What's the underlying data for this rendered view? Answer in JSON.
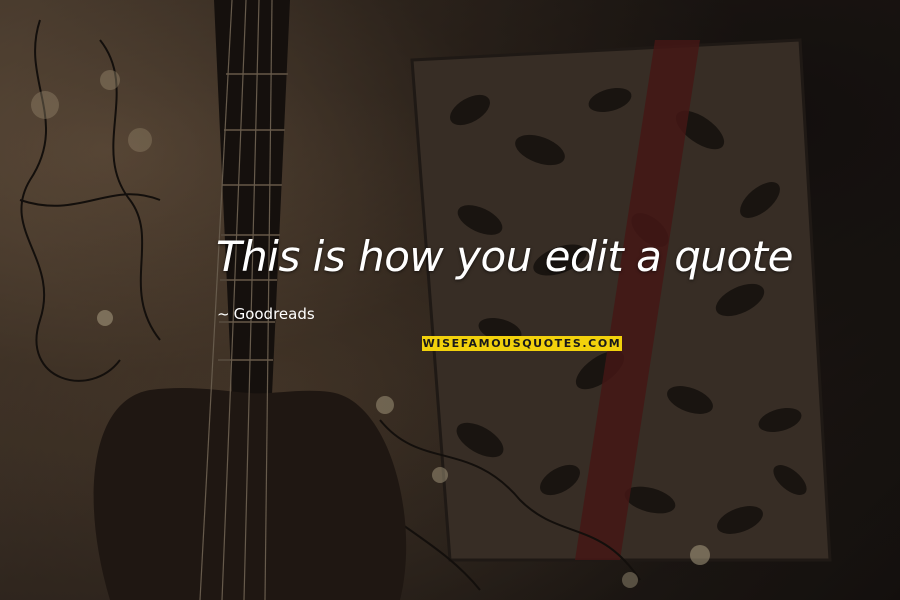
{
  "quote": {
    "text": "This is how you edit a quote",
    "author_dash": "~",
    "author": "Goodreads"
  },
  "watermark": {
    "text": "WISEFAMOUSQUOTES.COM",
    "background": "#f2d10c"
  },
  "colors": {
    "quote_text": "#ffffff",
    "background": "#2a221c"
  }
}
